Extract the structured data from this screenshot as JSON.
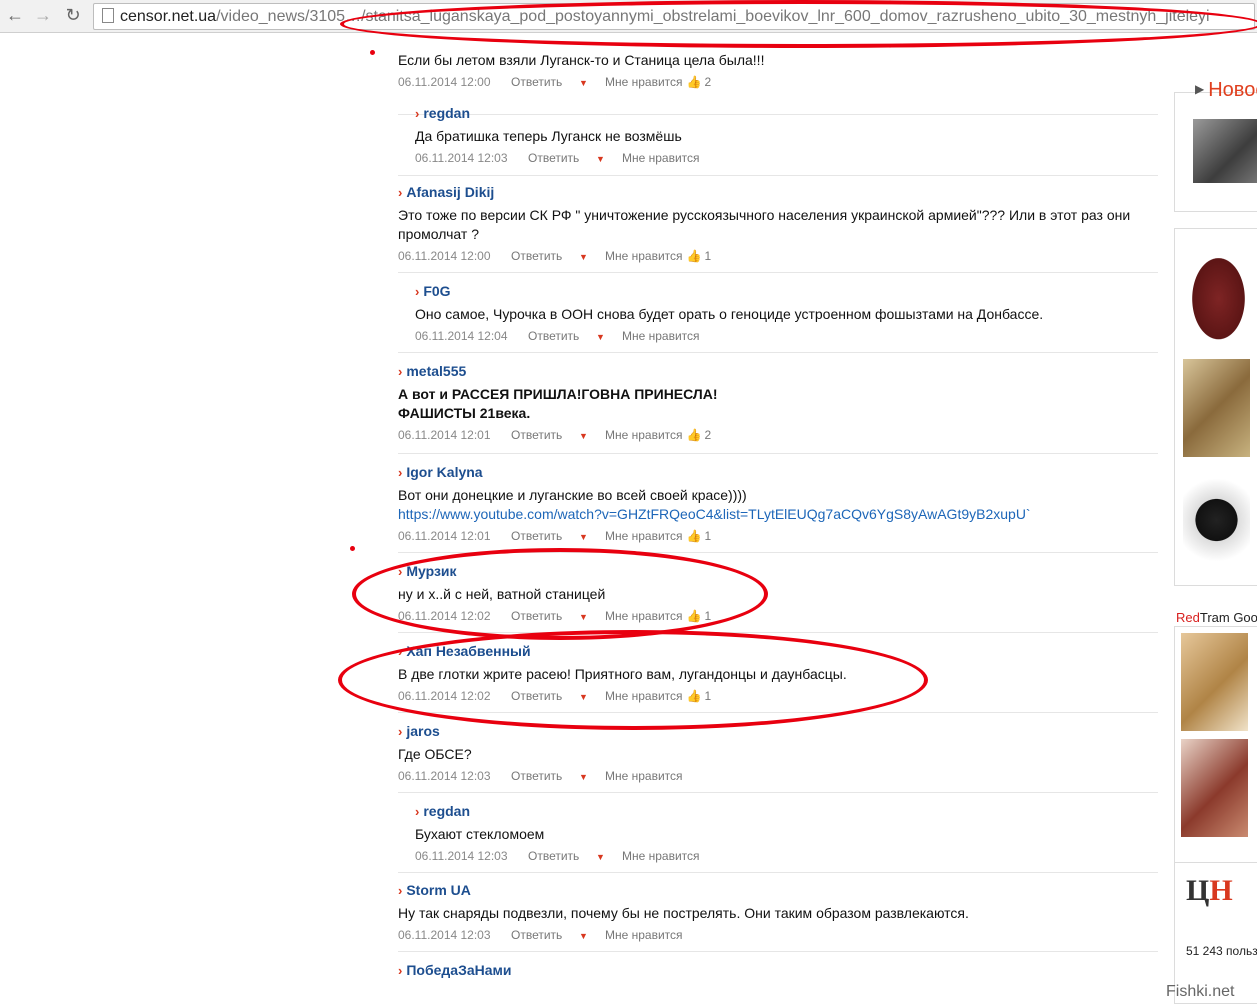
{
  "browser": {
    "url_domain": "censor.net.ua",
    "url_path": "/video_news/3105…/stanitsa_luganskaya_pod_postoyannymi_obstrelami_boevikov_lnr_600_domov_razrusheno_ubito_30_mestnyh_jiteleyi",
    "back_icon": "←",
    "forward_icon": "→",
    "reload_icon": "↻"
  },
  "labels": {
    "reply": "Ответить",
    "like": "Мне нравится",
    "chevron": "›",
    "arrow": "▼",
    "thumb": "👍"
  },
  "comments": [
    {
      "author": "",
      "text": "Если бы летом взяли Луганск-то и Станица цела была!!!",
      "date": "06.11.2014 12:00",
      "likes": "2",
      "reply": false
    },
    {
      "author": "regdan",
      "text": "Да братишка теперь Луганск не возмёшь",
      "date": "06.11.2014 12:03",
      "likes": "",
      "reply": true
    },
    {
      "author": "Afanasij Dikij",
      "text": "Это тоже по версии СК РФ \" уничтожение русскоязычного населения украинской армией\"??? Или в этот раз они промолчат ?",
      "date": "06.11.2014 12:00",
      "likes": "1",
      "reply": false
    },
    {
      "author": "F0G",
      "text": "Оно самое, Чурочка в ООН снова будет орать о геноциде устроенном фошызтами на Донбассе.",
      "date": "06.11.2014 12:04",
      "likes": "",
      "reply": true
    },
    {
      "author": "metal555",
      "text": "А вот и РАССЕЯ ПРИШЛА!ГОВНА ПРИНЕСЛА!",
      "text2": "ФАШИСТЫ 21века.",
      "date": "06.11.2014 12:01",
      "likes": "2",
      "reply": false
    },
    {
      "author": "Igor Kalyna",
      "text": "Вот они донецкие и луганские во всей своей красе))))",
      "link": "https://www.youtube.com/watch?v=GHZtFRQeoC4&list=TLytElEUQg7aCQv6YgS8yAwAGt9yB2xupU`",
      "date": "06.11.2014 12:01",
      "likes": "1",
      "reply": false
    },
    {
      "author": "Мурзик",
      "text": "ну и х..й с ней, ватной станицей",
      "date": "06.11.2014 12:02",
      "likes": "1",
      "reply": false
    },
    {
      "author": "Хап Незабвенный",
      "text": "В две глотки жрите расею! Приятного вам, лугандонцы и даунбасцы.",
      "date": "06.11.2014 12:02",
      "likes": "1",
      "reply": false
    },
    {
      "author": "jaros",
      "text": "Где ОБСЕ?",
      "date": "06.11.2014 12:03",
      "likes": "",
      "reply": false
    },
    {
      "author": "regdan",
      "text": "Бухают стекломоем",
      "date": "06.11.2014 12:03",
      "likes": "",
      "reply": true
    },
    {
      "author": "Storm UA",
      "text": "Ну так снаряды подвезли, почему бы не пострелять. Они таким образом развлекаются.",
      "date": "06.11.2014 12:03",
      "likes": "",
      "reply": false
    },
    {
      "author": "ПобедаЗаНами",
      "text": "",
      "date": "",
      "likes": "",
      "reply": false
    }
  ],
  "sidebar": {
    "news_title": "Новос",
    "redtram_red": "Red",
    "redtram_rest": "Tram Goo",
    "logo_c": "Ц",
    "logo_n": "Н",
    "fb_count": "51 243 польз"
  },
  "watermark": "Fishki.net",
  "colors": {
    "annotation": "#e8000f",
    "author": "#1d4e8f",
    "accent": "#d8381f"
  }
}
